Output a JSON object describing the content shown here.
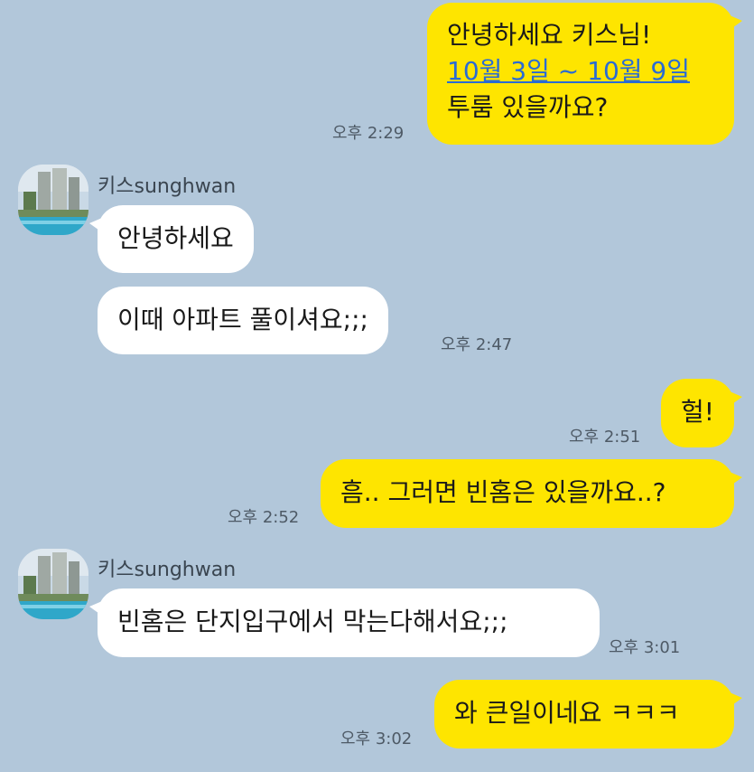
{
  "messages": [
    {
      "id": "m1",
      "from": "me",
      "lines": [
        "안녕하세요 키스님!",
        "10월 3일 ~ 10월 9일",
        "투룸 있을까요?"
      ],
      "time": "오후 2:29"
    },
    {
      "id": "m2",
      "from": "other",
      "sender": "키스sunghwan",
      "text": "안녕하세요"
    },
    {
      "id": "m3",
      "from": "other",
      "text": "이때 아파트 풀이셔요;;;",
      "time": "오후 2:47"
    },
    {
      "id": "m4",
      "from": "me",
      "text": "헐!",
      "time": "오후 2:51"
    },
    {
      "id": "m5",
      "from": "me",
      "text": "흠.. 그러면 빈홈은 있을까요..?",
      "time": "오후 2:52"
    },
    {
      "id": "m6",
      "from": "other",
      "sender": "키스sunghwan",
      "text": "빈홈은 단지입구에서 막는다해서요;;;",
      "time": "오후 3:01"
    },
    {
      "id": "m7",
      "from": "me",
      "text": "와 큰일이네요 ㅋㅋㅋ",
      "time": "오후 3:02"
    }
  ],
  "colors": {
    "background": "#b2c7da",
    "my_bubble": "#fee500",
    "other_bubble": "#ffffff",
    "link": "#2a6bd4"
  }
}
